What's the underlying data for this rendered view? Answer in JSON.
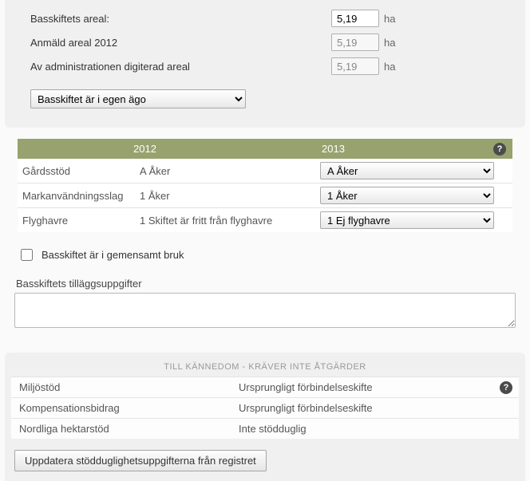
{
  "areal": {
    "rows": [
      {
        "label": "Basskiftets areal:",
        "value": "5,19",
        "unit": "ha",
        "editable": true
      },
      {
        "label": "Anmäld areal 2012",
        "value": "5,19",
        "unit": "ha",
        "editable": false
      },
      {
        "label": "Av administrationen digiterad areal",
        "value": "5,19",
        "unit": "ha",
        "editable": false
      }
    ]
  },
  "ownership_select": "Basskiftet är i egen ägo",
  "year_table": {
    "headers": {
      "c1": "2012",
      "c2": "2013"
    },
    "rows": [
      {
        "label": "Gårdsstöd",
        "v2012": "A Åker",
        "v2013": "A Åker"
      },
      {
        "label": "Markanvändningsslag",
        "v2012": "1 Åker",
        "v2013": "1 Åker"
      },
      {
        "label": "Flyghavre",
        "v2012": "1 Skiftet är fritt från flyghavre",
        "v2013": "1 Ej flyghavre"
      }
    ]
  },
  "shared_use": {
    "label": "Basskiftet är i gemensamt bruk",
    "checked": false
  },
  "extra_info": {
    "label": "Basskiftets tilläggsuppgifter",
    "value": ""
  },
  "notice": {
    "heading": "TILL KÄNNEDOM - KRÄVER INTE ÅTGÄRDER",
    "rows": [
      {
        "label": "Miljöstöd",
        "value": "Ursprungligt förbindelseskifte",
        "help": true
      },
      {
        "label": "Kompensationsbidrag",
        "value": "Ursprungligt förbindelseskifte",
        "help": false
      },
      {
        "label": "Nordliga hektarstöd",
        "value": "Inte stödduglig",
        "help": false
      }
    ],
    "button": "Uppdatera stödduglighetsuppgifterna från registret"
  },
  "help_glyph": "?"
}
